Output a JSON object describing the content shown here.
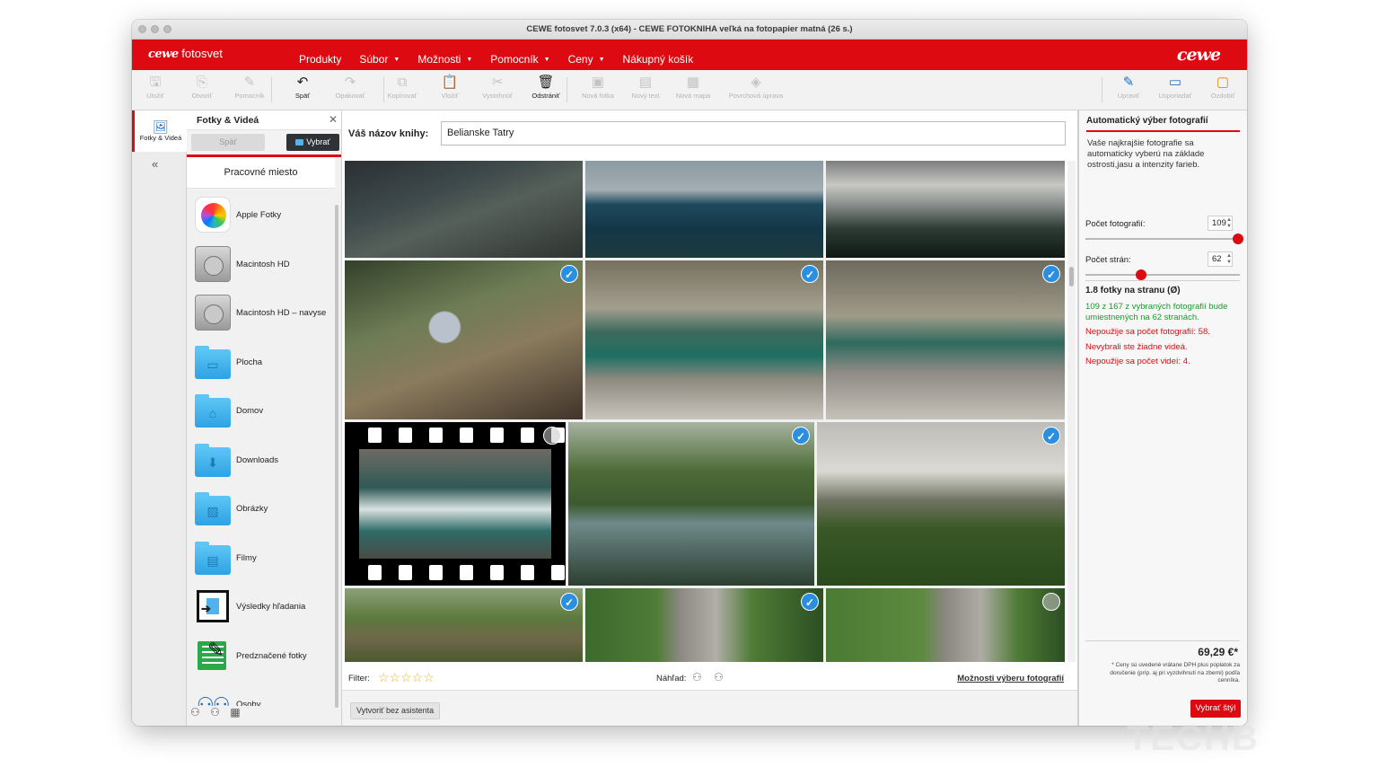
{
  "window": {
    "title": "CEWE fotosvet 7.0.3 (x64) - CEWE FOTOKNIHA veľká na fotopapier matná (26 s.)"
  },
  "menubar": {
    "logo_left_brand": "cewe",
    "logo_left_suffix": "fotosvet",
    "items": [
      {
        "label": "Produkty",
        "caret": false
      },
      {
        "label": "Súbor",
        "caret": true
      },
      {
        "label": "Možnosti",
        "caret": true
      },
      {
        "label": "Pomocník",
        "caret": true
      },
      {
        "label": "Ceny",
        "caret": true
      },
      {
        "label": "Nákupný košík",
        "caret": false
      }
    ],
    "logo_right": "cewe",
    "brand_color": "#dd0a12"
  },
  "toolbar": {
    "items": [
      {
        "label": "Uložiť",
        "icon": "save-icon",
        "enabled": false
      },
      {
        "label": "Otvoriť",
        "icon": "open-icon",
        "enabled": false
      },
      {
        "label": "Pomocník",
        "icon": "help-icon",
        "enabled": false
      },
      {
        "label": "Späť",
        "icon": "undo-icon",
        "enabled": true
      },
      {
        "label": "Opakovať",
        "icon": "redo-icon",
        "enabled": false
      },
      {
        "label": "Kopírovať",
        "icon": "copy-icon",
        "enabled": false
      },
      {
        "label": "Vložiť",
        "icon": "paste-icon",
        "enabled": false
      },
      {
        "label": "Vystrihnúť",
        "icon": "cut-icon",
        "enabled": false
      },
      {
        "label": "Odstrániť",
        "icon": "trash-icon",
        "enabled": true
      },
      {
        "label": "Nová fotka",
        "icon": "new-photo-icon",
        "enabled": false
      },
      {
        "label": "Nový text",
        "icon": "new-text-icon",
        "enabled": false
      },
      {
        "label": "Nová mapa",
        "icon": "new-map-icon",
        "enabled": false
      },
      {
        "label": "Povrchová úprava",
        "icon": "finish-icon",
        "enabled": false
      },
      {
        "label": "Upraviť",
        "icon": "edit-icon",
        "enabled": false
      },
      {
        "label": "Usporiadať",
        "icon": "arrange-icon",
        "enabled": false
      },
      {
        "label": "Ozdobiť",
        "icon": "decorate-icon",
        "enabled": false
      }
    ]
  },
  "vtabs": {
    "active_label": "Fotky & Videá",
    "collapse_glyph": "«"
  },
  "source_panel": {
    "title": "Fotky & Videá",
    "back_label": "Späť",
    "select_label": "Vybrať",
    "workplace_label": "Pracovné miesto",
    "items": [
      {
        "label": "Apple Fotky",
        "icon": "apple-photos-icon"
      },
      {
        "label": "Macintosh HD",
        "icon": "hard-drive-icon"
      },
      {
        "label": "Macintosh HD – navyse",
        "icon": "hard-drive-icon"
      },
      {
        "label": "Plocha",
        "icon": "desktop-folder-icon"
      },
      {
        "label": "Domov",
        "icon": "home-folder-icon"
      },
      {
        "label": "Downloads",
        "icon": "downloads-folder-icon"
      },
      {
        "label": "Obrázky",
        "icon": "pictures-folder-icon"
      },
      {
        "label": "Filmy",
        "icon": "movies-folder-icon"
      },
      {
        "label": "Výsledky hľadania",
        "icon": "search-results-icon"
      },
      {
        "label": "Predznačené fotky",
        "icon": "premarked-photos-icon"
      },
      {
        "label": "Osoby",
        "icon": "people-icon"
      }
    ]
  },
  "main": {
    "book_title_label": "Váš názov knihy:",
    "book_title_value": "Belianske Tatry",
    "filter_label": "Filter:",
    "filter_stars": "☆☆☆☆☆",
    "preview_label": "Náhľad:",
    "options_link": "Možnosti výberu fotografií",
    "create_button": "Vytvoriť bez asistenta",
    "photos": [
      {
        "scene": "mountain-slope",
        "selected": null
      },
      {
        "scene": "mountain-ridge-blue",
        "selected": null
      },
      {
        "scene": "mountain-forest-sunrays",
        "selected": null
      },
      {
        "scene": "mushroom",
        "selected": true
      },
      {
        "scene": "stream-rocks",
        "selected": true
      },
      {
        "scene": "stream-rocks-2",
        "selected": true
      },
      {
        "scene": "waterfall-video",
        "selected": false
      },
      {
        "scene": "forest-pond",
        "selected": true
      },
      {
        "scene": "mountain-peak",
        "selected": true
      },
      {
        "scene": "forest-person",
        "selected": true
      },
      {
        "scene": "trail-sign",
        "selected": true
      },
      {
        "scene": "trail-sign-2",
        "selected": false
      }
    ]
  },
  "right_panel": {
    "title": "Automatický výber fotografií",
    "description": "Vaše najkrajšie fotografie sa automaticky vyberú na základe ostrosti,jasu a intenzity farieb.",
    "photo_count_label": "Počet fotografií:",
    "photo_count_value": "109",
    "photo_count_fraction": 1.0,
    "page_count_label": "Počet strán:",
    "page_count_value": "62",
    "page_count_fraction": 0.36,
    "ratio_label": "1.8 fotky na stranu (Ø)",
    "msg_green": "109 z 167 z vybraných fotografií bude umiestnených na 62 stranách.",
    "msg_red_1": "Nepoužije sa počet fotografií: 58.",
    "msg_red_2": "Nevybrali ste žiadne videá.",
    "msg_red_3": "Nepoužije sa počet videí: 4.",
    "price": "69,29 €*",
    "price_note": "* Ceny sú uvedené vrátane DPH plus poplatok za doručenie (príp. aj pri vyzdvihnutí na zberni) podľa cenníka.",
    "choose_style_button": "Vybrať štýl"
  },
  "watermark": "TECHB"
}
